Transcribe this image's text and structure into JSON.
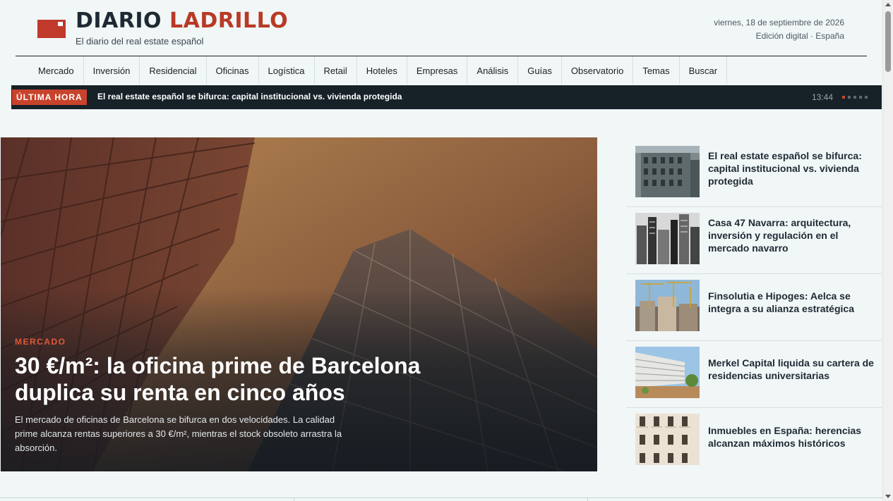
{
  "brand": {
    "part1": "DIARIO",
    "part2": "LADRILLO",
    "tagline": "El diario del real estate español",
    "accent": "#b83a25"
  },
  "header": {
    "date": "viernes, 18 de septiembre de 2026",
    "edition": "Edición digital · España"
  },
  "nav": {
    "items": [
      "Mercado",
      "Inversión",
      "Residencial",
      "Oficinas",
      "Logística",
      "Retail",
      "Hoteles",
      "Empresas",
      "Análisis",
      "Guías",
      "Observatorio",
      "Temas",
      "Buscar"
    ]
  },
  "breaking": {
    "badge": "ÚLTIMA HORA",
    "headline": "El real estate español se bifurca: capital institucional vs. vivienda protegida",
    "time": "13:44",
    "total_slides": 5,
    "active_slide": 1
  },
  "hero": {
    "kicker": "MERCADO",
    "title": "30 €/m²: la oficina prime de Barcelona duplica su renta en cinco años",
    "summary": "El mercado de oficinas de Barcelona se bifurca en dos velocidades. La calidad prime alcanza rentas superiores a 30 €/m², mientras el stock obsoleto arrastra la absorción.",
    "image": "office-tower-upward-photo"
  },
  "side_stories": [
    {
      "title": "El real estate español se bifurca: capital institucional vs. vivienda protegida",
      "image": "classic-building-facade-photo"
    },
    {
      "title": "Casa 47 Navarra: arquitectura, inversión y regulación en el mercado navarro",
      "image": "city-skyline-bw-photo"
    },
    {
      "title": "Finsolutia e Hipoges: Aelca se integra a su alianza estratégica",
      "image": "construction-cranes-photo"
    },
    {
      "title": "Merkel Capital liquida su cartera de residencias universitarias",
      "image": "student-residence-photo"
    },
    {
      "title": "Inmuebles en España: herencias alcanzan máximos históricos",
      "image": "apartment-windows-photo"
    }
  ]
}
